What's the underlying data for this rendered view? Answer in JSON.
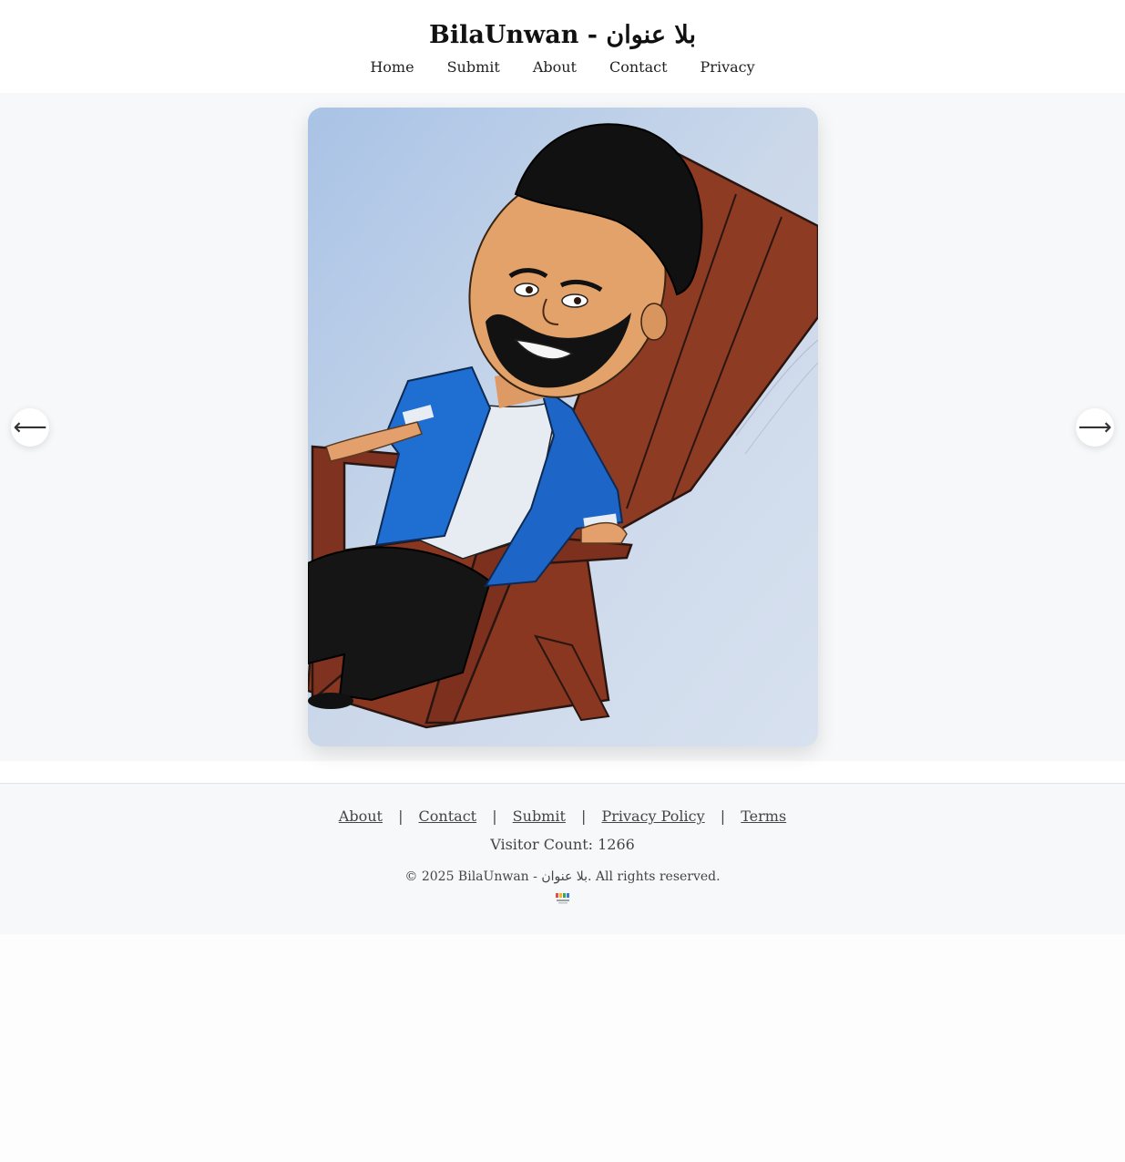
{
  "site": {
    "title": "BilaUnwan - بلا عنوان"
  },
  "nav": {
    "items": [
      {
        "label": "Home"
      },
      {
        "label": "Submit"
      },
      {
        "label": "About"
      },
      {
        "label": "Contact"
      },
      {
        "label": "Privacy"
      }
    ]
  },
  "gallery": {
    "prev_label": "⟵",
    "next_label": "⟶",
    "artwork_alt": "Colored pencil drawing of a smiling bearded man in a blue open shirt, white tee and black pants, leaning back in a brown wooden Adirondack chair"
  },
  "footer": {
    "links": [
      {
        "label": "About"
      },
      {
        "label": "Contact"
      },
      {
        "label": "Submit"
      },
      {
        "label": "Privacy Policy"
      },
      {
        "label": "Terms"
      }
    ],
    "separator": "|",
    "visitor_count": "Visitor Count: 1266",
    "copyright": "© 2025 BilaUnwan - بلا عنوان. All rights reserved."
  },
  "colors": {
    "header_bg": "#ffffff",
    "gallery_bg": "#f7f8f9",
    "footer_bg": "#f7f8f9",
    "chair": "#8b3a22",
    "shirt": "#1e6fd0",
    "skin": "#e0a06a"
  }
}
